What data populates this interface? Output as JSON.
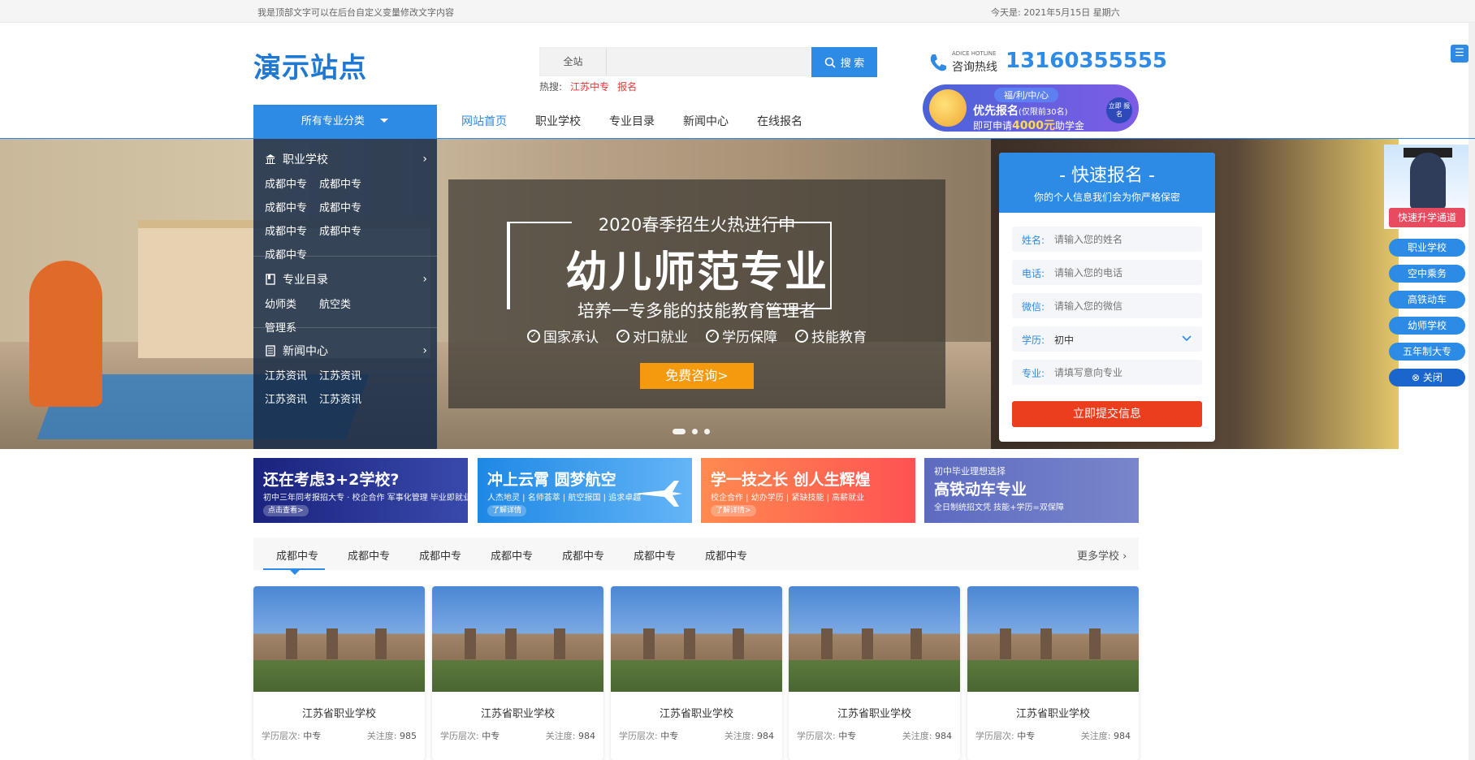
{
  "topbar": {
    "left_text": "我是顶部文字可以在后台自定义变量修改文字内容",
    "date": "今天是:   2021年5月15日 星期六"
  },
  "header": {
    "logo": "演示站点",
    "search": {
      "scope": "全站",
      "placeholder": "",
      "button": "搜 索"
    },
    "hot": {
      "label": "热搜:",
      "items": [
        "江苏中专",
        "报名"
      ]
    },
    "hotline": {
      "sub": "ADICE HOTLINE",
      "label": "咨询热线",
      "number": "13160355555"
    },
    "promo": {
      "pill": "福/利/中/心",
      "title": "优先报名",
      "title_note": "(仅限前30名)",
      "line_pre": "即可申请",
      "line_amount": "4000元",
      "line_post": "助学金",
      "circle": "立即 报名"
    }
  },
  "nav": {
    "category_btn": "所有专业分类",
    "items": [
      "网站首页",
      "职业学校",
      "专业目录",
      "新闻中心",
      "在线报名"
    ],
    "active": 0
  },
  "sidebar": {
    "sections": [
      {
        "title": "职业学校",
        "links": [
          "成都中专",
          "成都中专",
          "成都中专",
          "成都中专",
          "成都中专",
          "成都中专",
          "成都中专"
        ]
      },
      {
        "title": "专业目录",
        "links": [
          "幼师类",
          "航空类",
          "管理系"
        ]
      },
      {
        "title": "新闻中心",
        "links": [
          "江苏资讯",
          "江苏资讯",
          "江苏资讯",
          "江苏资讯"
        ]
      }
    ]
  },
  "banner": {
    "sub": "2020春季招生火热进行中",
    "title": "幼儿师范专业",
    "line": "培养一专多能的技能教育管理者",
    "features": [
      "国家承认",
      "对口就业",
      "学历保障",
      "技能教育"
    ],
    "button": "免费咨询>"
  },
  "form": {
    "title": "- 快速报名 -",
    "subtitle": "你的个人信息我们会为你严格保密",
    "fields": [
      {
        "label": "姓名:",
        "placeholder": "请输入您的姓名"
      },
      {
        "label": "电话:",
        "placeholder": "请输入您的电话"
      },
      {
        "label": "微信:",
        "placeholder": "请输入您的微信"
      },
      {
        "label": "学历:",
        "value": "初中"
      },
      {
        "label": "专业:",
        "placeholder": "请填写意向专业"
      }
    ],
    "submit": "立即提交信息"
  },
  "float": {
    "title": "快速升学通道",
    "items": [
      "职业学校",
      "空中乘务",
      "高铁动车",
      "幼师学校",
      "五年制大专"
    ],
    "close": "关闭"
  },
  "ads": [
    {
      "title": "还在考虑3+2学校?",
      "sub": "初中三年同考报招大专 · 校企合作 军事化管理 毕业即就业",
      "btn": "点击查看>",
      "c1": "#1a237e",
      "c2": "#3949ab"
    },
    {
      "title": "冲上云霄 圆梦航空",
      "sub": "人杰地灵 | 名师荟萃 | 航空报国 | 追求卓越",
      "btn": "了解详情",
      "c1": "#1e88e5",
      "c2": "#64b5f6"
    },
    {
      "title": "学一技之长 创人生辉煌",
      "sub": "校企合作 | 幼办学历 | 紧缺技能 | 高薪就业",
      "btn": "了解详情>",
      "c1": "#ff7043",
      "c2": "#ff5252"
    },
    {
      "title": "高铁动车专业",
      "sub": "全日制统招文凭  技能+学历=双保障",
      "btn": "初中毕业理想选择",
      "c1": "#5c6bc0",
      "c2": "#7986cb"
    }
  ],
  "schools": {
    "tabs": [
      "成都中专",
      "成都中专",
      "成都中专",
      "成都中专",
      "成都中专",
      "成都中专",
      "成都中专"
    ],
    "more": "更多学校",
    "cards": [
      {
        "name": "江苏省职业学校",
        "level_label": "学历层次:",
        "level": "中专",
        "fans_label": "关注度:",
        "fans": "985"
      },
      {
        "name": "江苏省职业学校",
        "level_label": "学历层次:",
        "level": "中专",
        "fans_label": "关注度:",
        "fans": "984"
      },
      {
        "name": "江苏省职业学校",
        "level_label": "学历层次:",
        "level": "中专",
        "fans_label": "关注度:",
        "fans": "984"
      },
      {
        "name": "江苏省职业学校",
        "level_label": "学历层次:",
        "level": "中专",
        "fans_label": "关注度:",
        "fans": "984"
      },
      {
        "name": "江苏省职业学校",
        "level_label": "学历层次:",
        "level": "中专",
        "fans_label": "关注度:",
        "fans": "984"
      }
    ]
  },
  "colors": {
    "primary": "#2d8ae5",
    "accent": "#ea3e1f",
    "orange": "#f59a0c"
  }
}
